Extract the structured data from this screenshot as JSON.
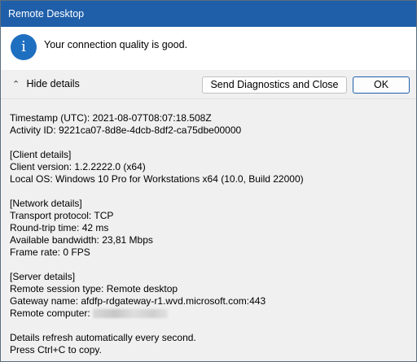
{
  "window": {
    "title": "Remote Desktop"
  },
  "message": {
    "icon": "info-icon",
    "text": "Your connection quality is good."
  },
  "buttons": {
    "hide_details": "Hide details",
    "send_diagnostics": "Send Diagnostics and Close",
    "ok": "OK"
  },
  "details": {
    "timestamp": "Timestamp (UTC): 2021-08-07T08:07:18.508Z",
    "activity_id": "Activity ID: 9221ca07-8d8e-4dcb-8df2-ca75dbe00000",
    "client_header": "[Client details]",
    "client_version": "Client version: 1.2.2222.0 (x64)",
    "local_os": "Local OS: Windows 10 Pro for Workstations x64 (10.0, Build 22000)",
    "network_header": "[Network details]",
    "transport": "Transport protocol: TCP",
    "rtt": "Round-trip time: 42 ms",
    "bandwidth": "Available bandwidth: 23,81 Mbps",
    "frame_rate": "Frame rate: 0 FPS",
    "server_header": "[Server details]",
    "session_type": "Remote session type: Remote desktop",
    "gateway": "Gateway name: afdfp-rdgateway-r1.wvd.microsoft.com:443",
    "remote_computer_label": "Remote computer: ",
    "refresh_note": "Details refresh automatically every second.",
    "copy_note": "Press Ctrl+C to copy."
  },
  "colors": {
    "titlebar": "#1f5faa",
    "accent": "#1f6fc0",
    "details_bg": "#f0f0f0"
  }
}
